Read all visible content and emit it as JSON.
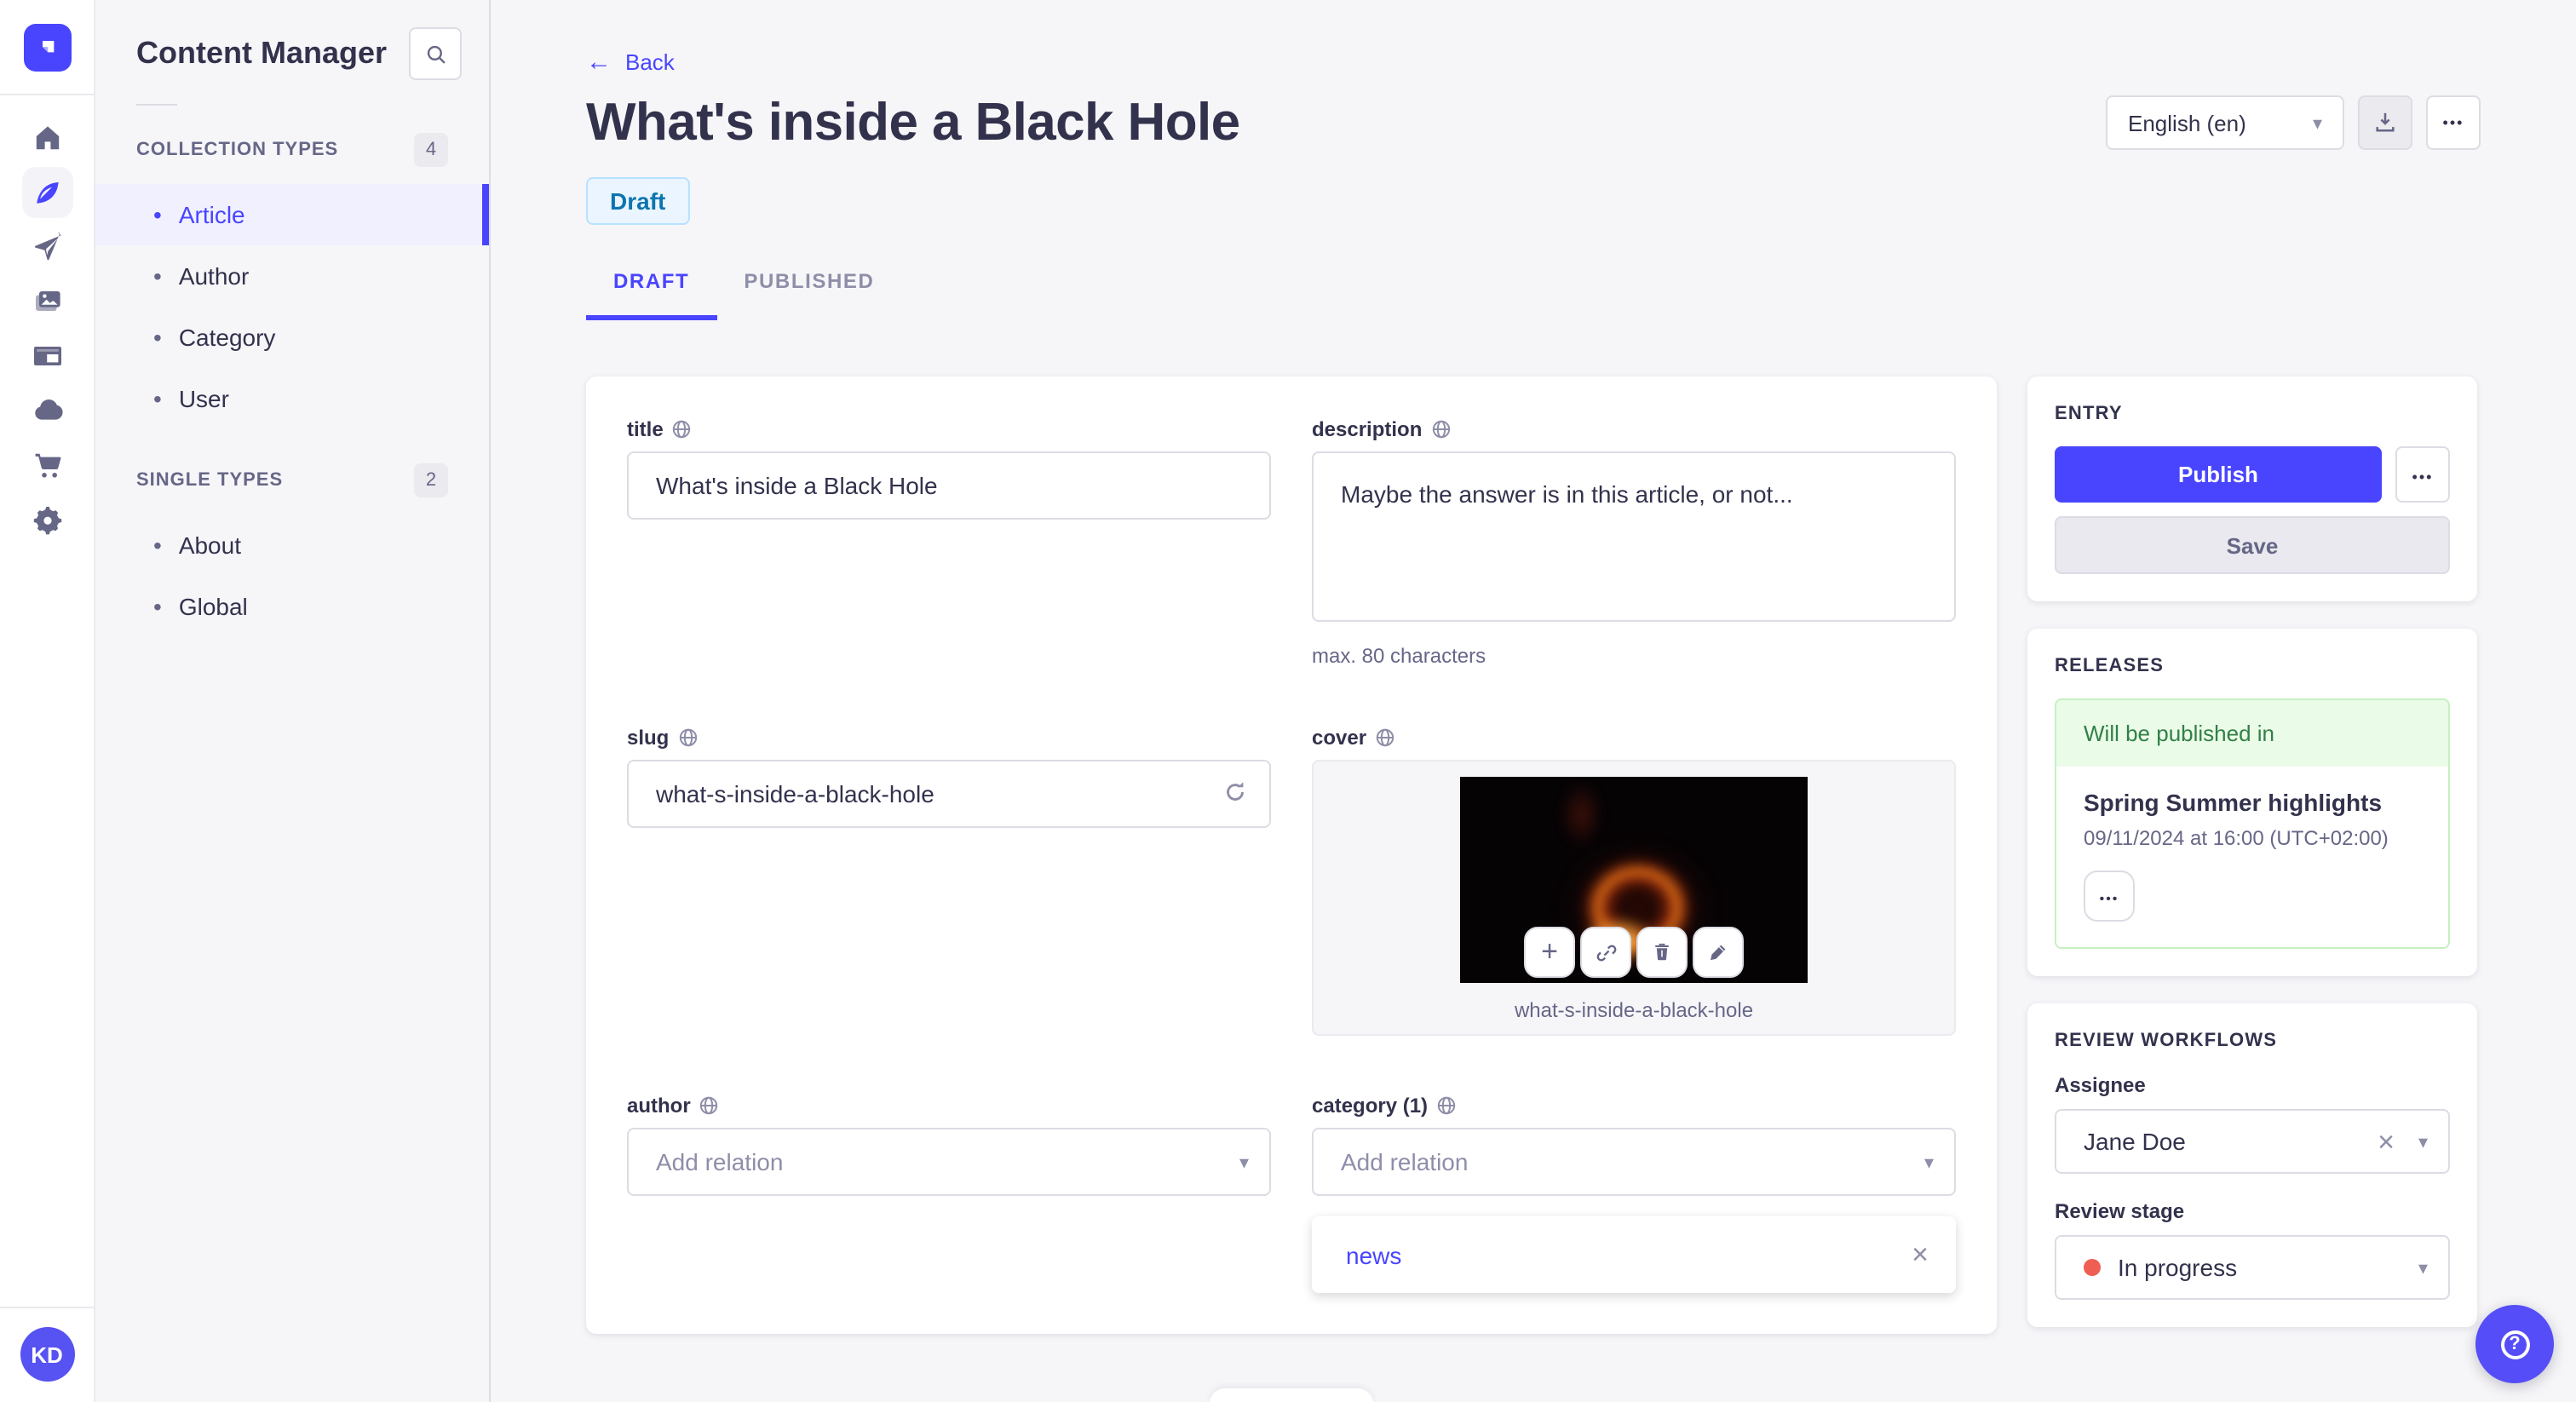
{
  "sidebar": {
    "title": "Content Manager",
    "sections": {
      "collection": {
        "label": "COLLECTION TYPES",
        "count": "4",
        "items": [
          {
            "label": "Article",
            "active": true
          },
          {
            "label": "Author",
            "active": false
          },
          {
            "label": "Category",
            "active": false
          },
          {
            "label": "User",
            "active": false
          }
        ]
      },
      "single": {
        "label": "SINGLE TYPES",
        "count": "2",
        "items": [
          {
            "label": "About",
            "active": false
          },
          {
            "label": "Global",
            "active": false
          }
        ]
      }
    }
  },
  "header": {
    "back": "Back",
    "title": "What's inside a Black Hole",
    "status": "Draft",
    "locale": "English (en)"
  },
  "tabs": {
    "draft": "DRAFT",
    "published": "PUBLISHED"
  },
  "form": {
    "title": {
      "label": "title",
      "value": "What's inside a Black Hole"
    },
    "description": {
      "label": "description",
      "value": "Maybe the answer is in this article, or not...",
      "helper": "max. 80 characters"
    },
    "slug": {
      "label": "slug",
      "value": "what-s-inside-a-black-hole"
    },
    "cover": {
      "label": "cover",
      "filename": "what-s-inside-a-black-hole"
    },
    "author": {
      "label": "author",
      "placeholder": "Add relation"
    },
    "category": {
      "label": "category (1)",
      "placeholder": "Add relation",
      "relations": [
        {
          "name": "news"
        }
      ]
    }
  },
  "entry": {
    "heading": "ENTRY",
    "publish": "Publish",
    "save": "Save"
  },
  "releases": {
    "heading": "RELEASES",
    "status": "Will be published in",
    "release_name": "Spring Summer highlights",
    "release_date": "09/11/2024 at 16:00 (UTC+02:00)"
  },
  "review": {
    "heading": "REVIEW WORKFLOWS",
    "assignee_label": "Assignee",
    "assignee_value": "Jane Doe",
    "stage_label": "Review stage",
    "stage_value": "In progress"
  },
  "user": {
    "initials": "KD"
  },
  "glyphs": {
    "back_arrow": "←",
    "chevron": "▾",
    "more": "•••",
    "plus": "+",
    "close": "×",
    "bullet": "•",
    "question": "?"
  },
  "colors": {
    "primary": "#4945FF",
    "primary_light": "#F0F0FF",
    "draft_bg": "#EAF5FF",
    "draft_border": "#B8E1FF",
    "draft_text": "#0C75AF",
    "success_bg": "#EAFBE7",
    "success_border": "#C6F0C2",
    "success_text": "#328048",
    "danger_dot": "#EE5E52"
  }
}
